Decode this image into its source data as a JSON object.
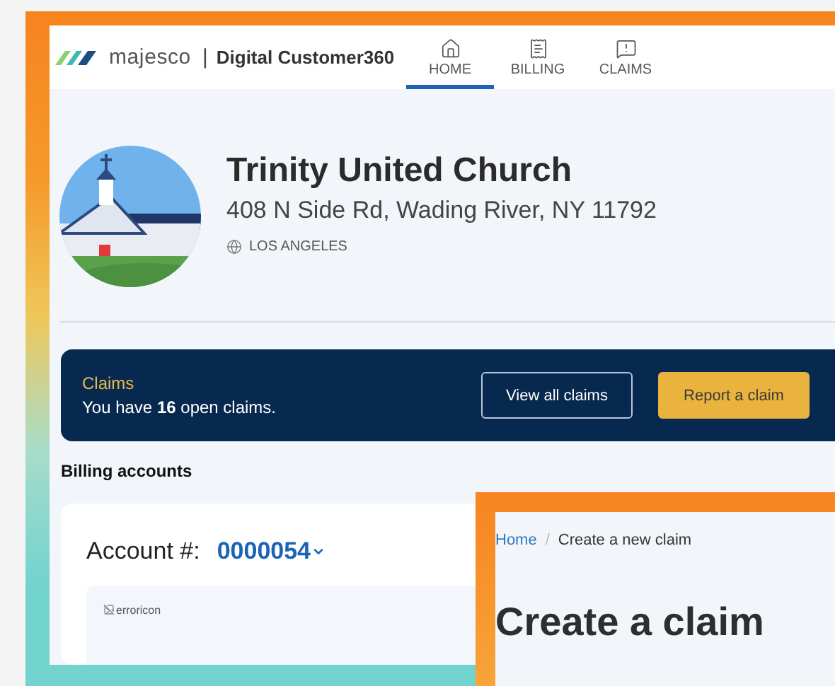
{
  "header": {
    "brand": "majesco",
    "separator": "|",
    "product": "Digital Customer360",
    "nav": [
      {
        "label": "HOME",
        "selected": true
      },
      {
        "label": "BILLING",
        "selected": false
      },
      {
        "label": "CLAIMS",
        "selected": false
      }
    ]
  },
  "profile": {
    "name": "Trinity United Church",
    "address": "408 N Side Rd, Wading River, NY 11792",
    "location": "LOS ANGELES"
  },
  "claims_banner": {
    "title": "Claims",
    "message": "You have **16** open claims.",
    "buttons": [
      {
        "label": "View all claims",
        "kind": "outline"
      },
      {
        "label": "Report a claim",
        "kind": "primary"
      }
    ]
  },
  "billing": {
    "heading": "Billing accounts",
    "account_label": "Account #:",
    "account_number": "0000054",
    "error_image_alt": "erroricon"
  },
  "overlay": {
    "breadcrumb": [
      {
        "label": "Home",
        "kind": "link"
      },
      {
        "label": "Create a new claim",
        "kind": "current"
      }
    ],
    "breadcrumb_separator": "/",
    "heading": "Create a claim"
  }
}
